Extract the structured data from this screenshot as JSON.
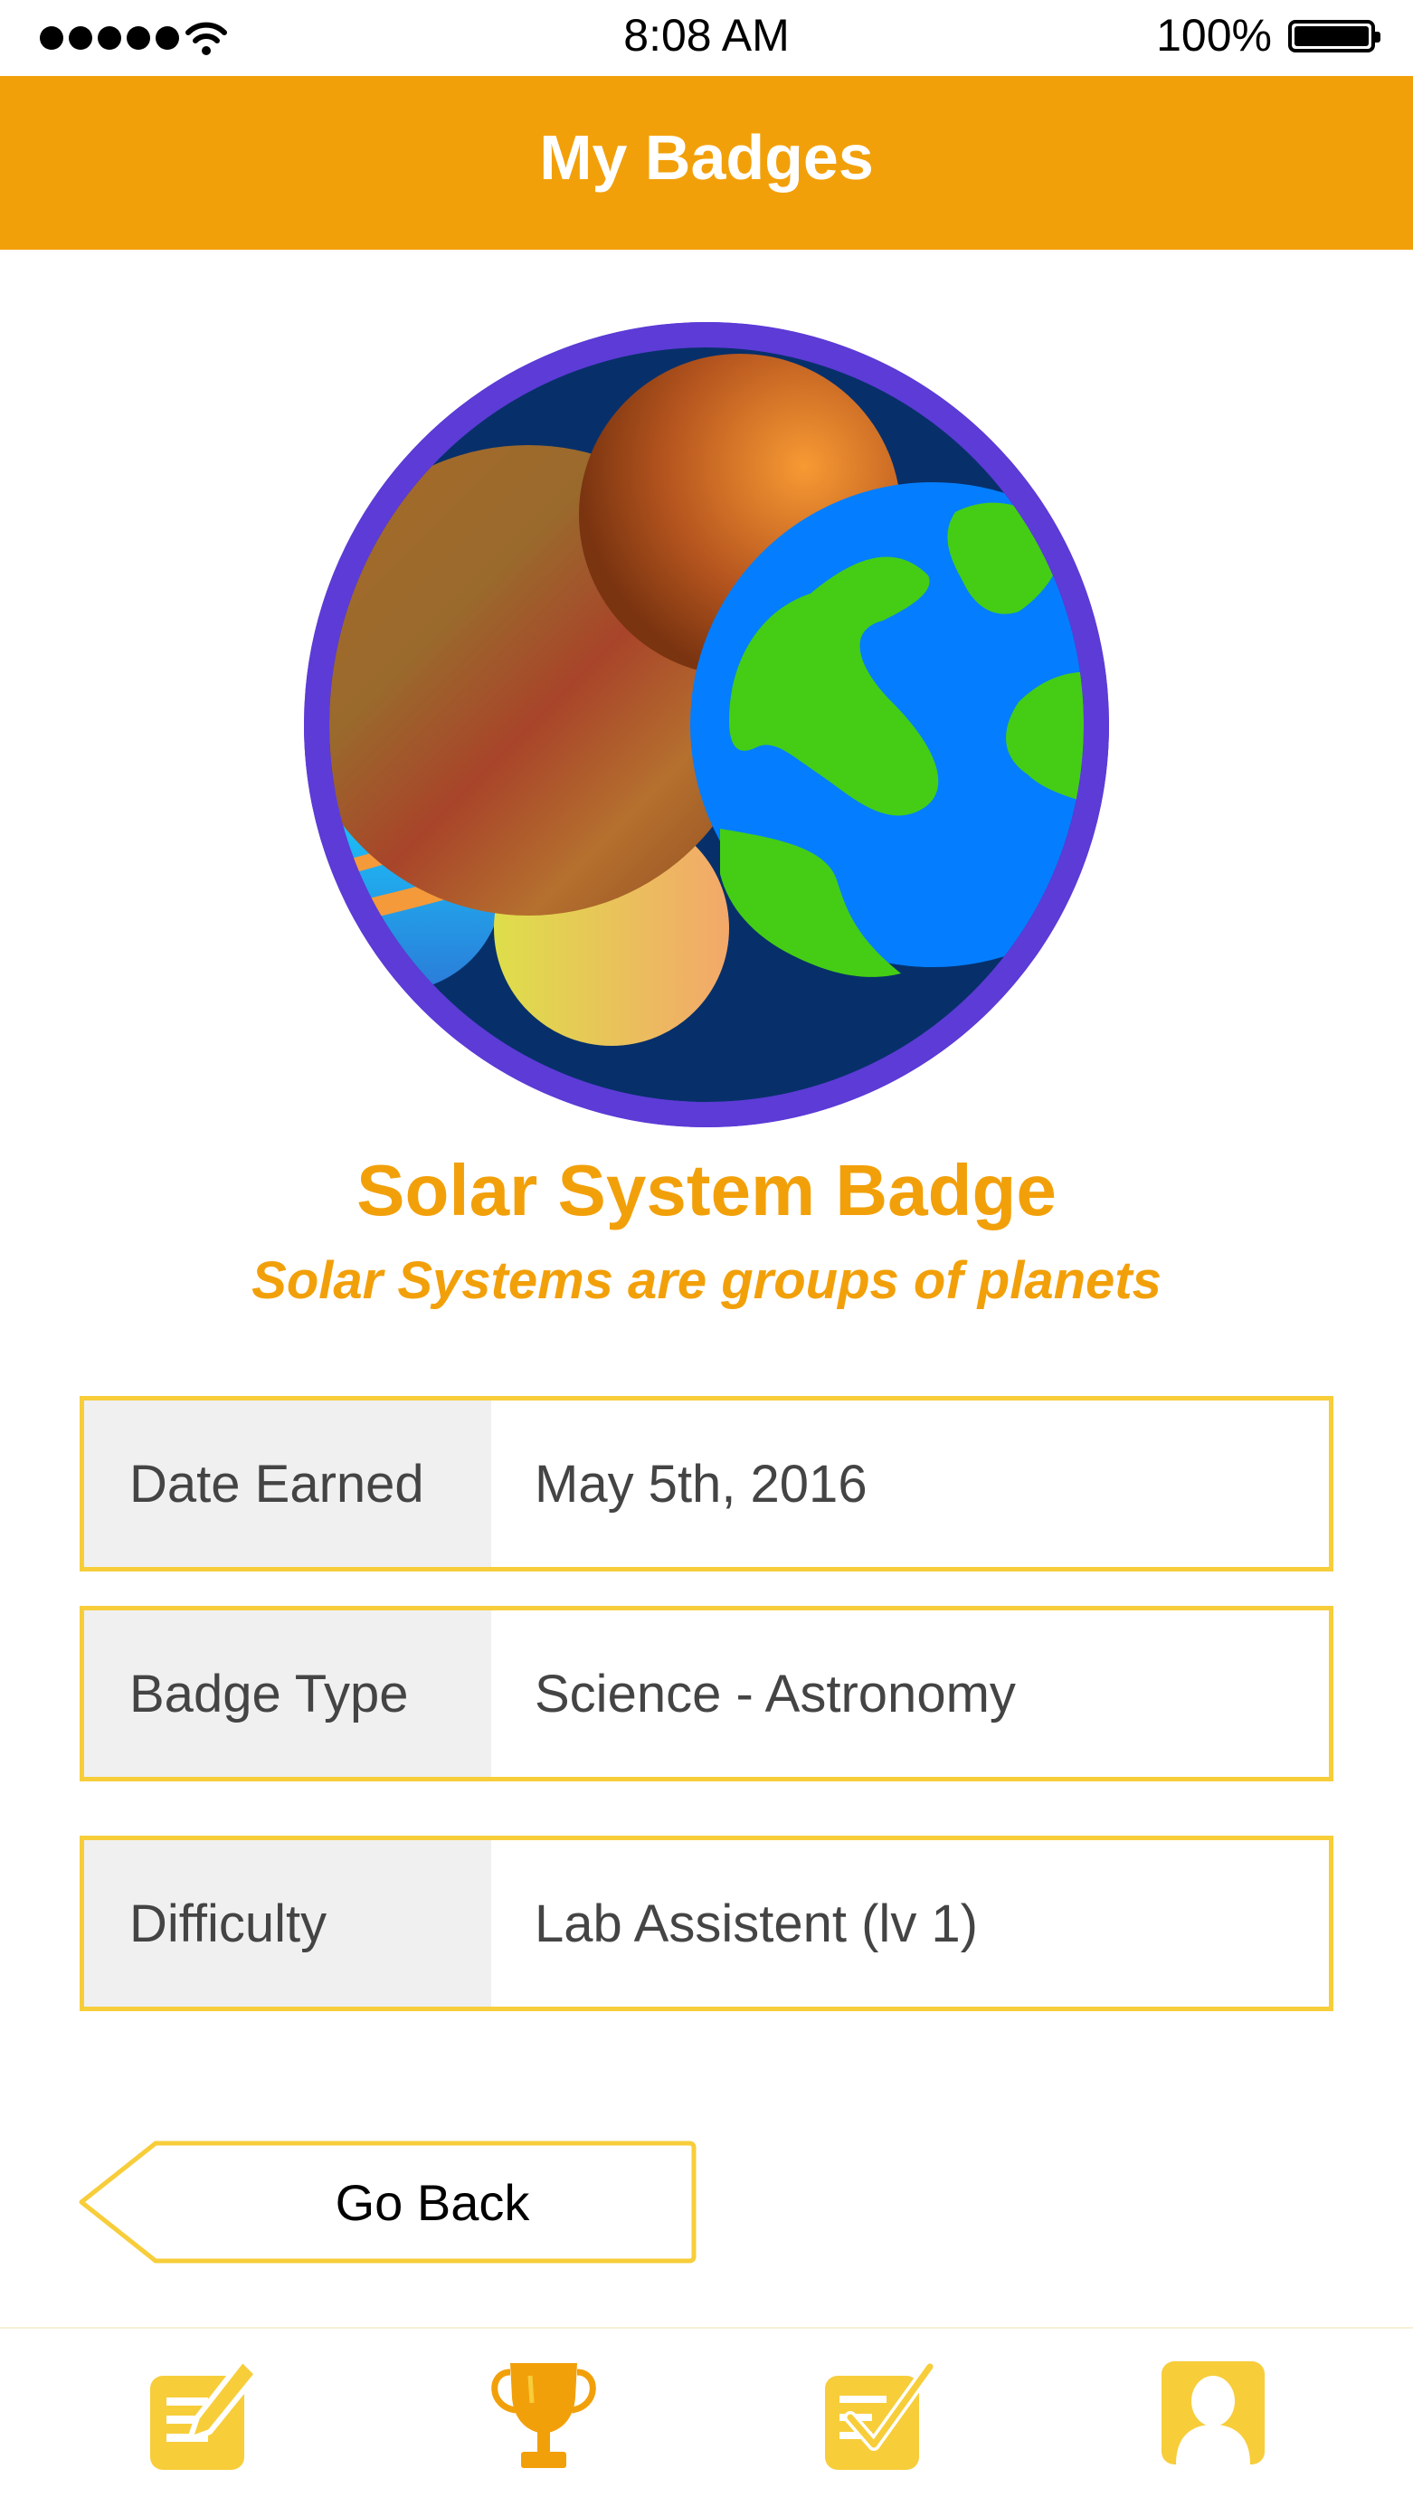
{
  "status_bar": {
    "time": "8:08 AM",
    "battery_percent": "100%",
    "signal_icon": "signal-dots-icon",
    "wifi_icon": "wifi-icon",
    "battery_icon": "battery-full-icon"
  },
  "header": {
    "title": "My Badges",
    "color": "#f2a00a"
  },
  "badge": {
    "image_icon": "solar-system-badge-icon",
    "title": "Solar System Badge",
    "subtitle": "Solar Systems are groups of planets",
    "ring_color": "#5c3bd6"
  },
  "details": [
    {
      "label": "Date Earned",
      "value": "May 5th, 2016"
    },
    {
      "label": "Badge Type",
      "value": "Science - Astronomy"
    },
    {
      "label": "Difficulty",
      "value": "Lab Assistent (lv 1)"
    }
  ],
  "actions": {
    "go_back_label": "Go Back"
  },
  "tab_bar": {
    "items": [
      {
        "icon": "edit-notes-icon"
      },
      {
        "icon": "trophy-icon"
      },
      {
        "icon": "checklist-icon"
      },
      {
        "icon": "profile-icon"
      }
    ],
    "accent": "#f7cd3a"
  }
}
